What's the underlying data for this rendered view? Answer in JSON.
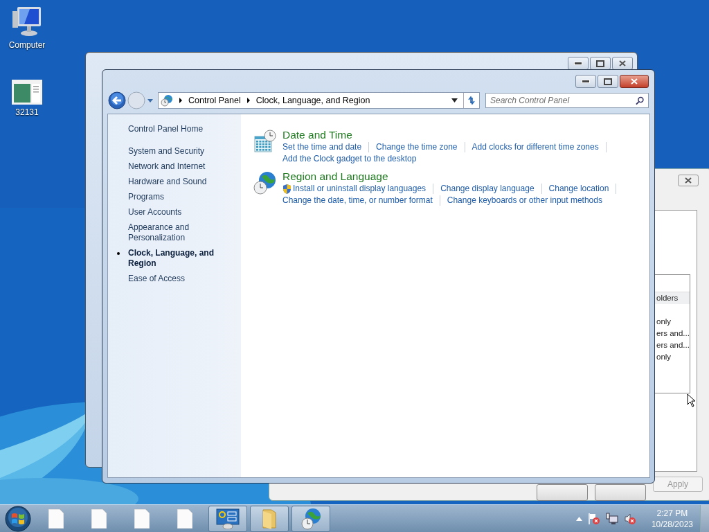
{
  "desktop_icons": [
    {
      "label": "Computer",
      "kind": "computer"
    },
    {
      "label": "32131",
      "kind": "document"
    }
  ],
  "back_dialog": {
    "list_items": [
      {
        "label": "olders",
        "selected": true
      },
      {
        "label": "only",
        "selected": false
      },
      {
        "label": "ers and...",
        "selected": false
      },
      {
        "label": "ers and...",
        "selected": false
      },
      {
        "label": "only",
        "selected": false
      }
    ],
    "buttons": [
      {
        "label": "Apply",
        "disabled": true
      }
    ]
  },
  "window": {
    "breadcrumb": [
      "Control Panel",
      "Clock, Language, and Region"
    ],
    "search": {
      "placeholder": "Search Control Panel"
    }
  },
  "sidebar": {
    "home": "Control Panel Home",
    "items": [
      {
        "label": "System and Security",
        "selected": false
      },
      {
        "label": "Network and Internet",
        "selected": false
      },
      {
        "label": "Hardware and Sound",
        "selected": false
      },
      {
        "label": "Programs",
        "selected": false
      },
      {
        "label": "User Accounts",
        "selected": false
      },
      {
        "label": "Appearance and Personalization",
        "selected": false
      },
      {
        "label": "Clock, Language, and Region",
        "selected": true
      },
      {
        "label": "Ease of Access",
        "selected": false
      }
    ]
  },
  "categories": [
    {
      "title": "Date and Time",
      "kind": "clock",
      "links": [
        {
          "label": "Set the time and date",
          "shield": false
        },
        {
          "label": "Change the time zone",
          "shield": false
        },
        {
          "label": "Add clocks for different time zones",
          "shield": false
        },
        {
          "label": "Add the Clock gadget to the desktop",
          "shield": false
        }
      ]
    },
    {
      "title": "Region and Language",
      "kind": "globe",
      "links": [
        {
          "label": "Install or uninstall display languages",
          "shield": true
        },
        {
          "label": "Change display language",
          "shield": false
        },
        {
          "label": "Change location",
          "shield": false
        },
        {
          "label": "Change the date, time, or number format",
          "shield": false
        },
        {
          "label": "Change keyboards or other input methods",
          "shield": false
        }
      ]
    }
  ],
  "taskbar": {
    "items": [
      {
        "kind": "document",
        "pinned": false
      },
      {
        "kind": "document",
        "pinned": false
      },
      {
        "kind": "document",
        "pinned": false
      },
      {
        "kind": "document",
        "pinned": false
      },
      {
        "kind": "control-panel",
        "pinned": true
      },
      {
        "kind": "folder",
        "pinned": true
      },
      {
        "kind": "globe",
        "pinned": true
      }
    ]
  },
  "clock": {
    "time": "2:27 PM",
    "date": "10/28/2023"
  }
}
